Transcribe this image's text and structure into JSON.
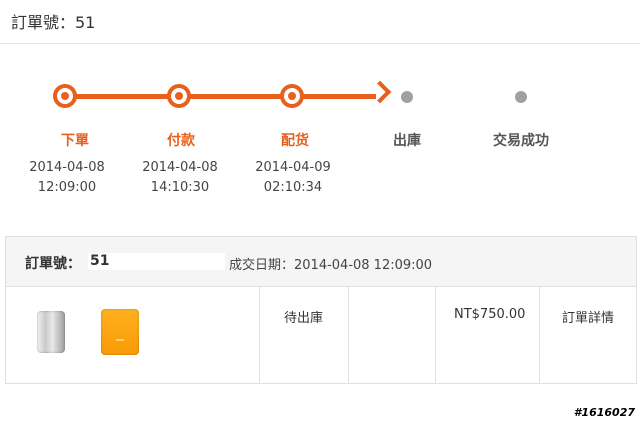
{
  "header": {
    "order_title": "訂單號：51"
  },
  "steps": [
    {
      "label": "下單",
      "date": "2014-04-08",
      "time": "12:09:00",
      "status": "done"
    },
    {
      "label": "付款",
      "date": "2014-04-08",
      "time": "14:10:30",
      "status": "done"
    },
    {
      "label": "配货",
      "date": "2014-04-09",
      "time": "02:10:34",
      "status": "done"
    },
    {
      "label": "出庫",
      "date": "",
      "time": "",
      "status": "pending"
    },
    {
      "label": "交易成功",
      "date": "",
      "time": "",
      "status": "pending"
    }
  ],
  "order": {
    "label": "訂單號：",
    "number": "51",
    "deal_date": "成交日期：2014-04-08 12:09:00",
    "status": "待出庫",
    "amount": "NT$750.00",
    "details_link": "訂單詳情"
  },
  "colors": {
    "accent": "#e8601c",
    "pending_dot": "#a0a0a0"
  },
  "watermark": "#1616027"
}
